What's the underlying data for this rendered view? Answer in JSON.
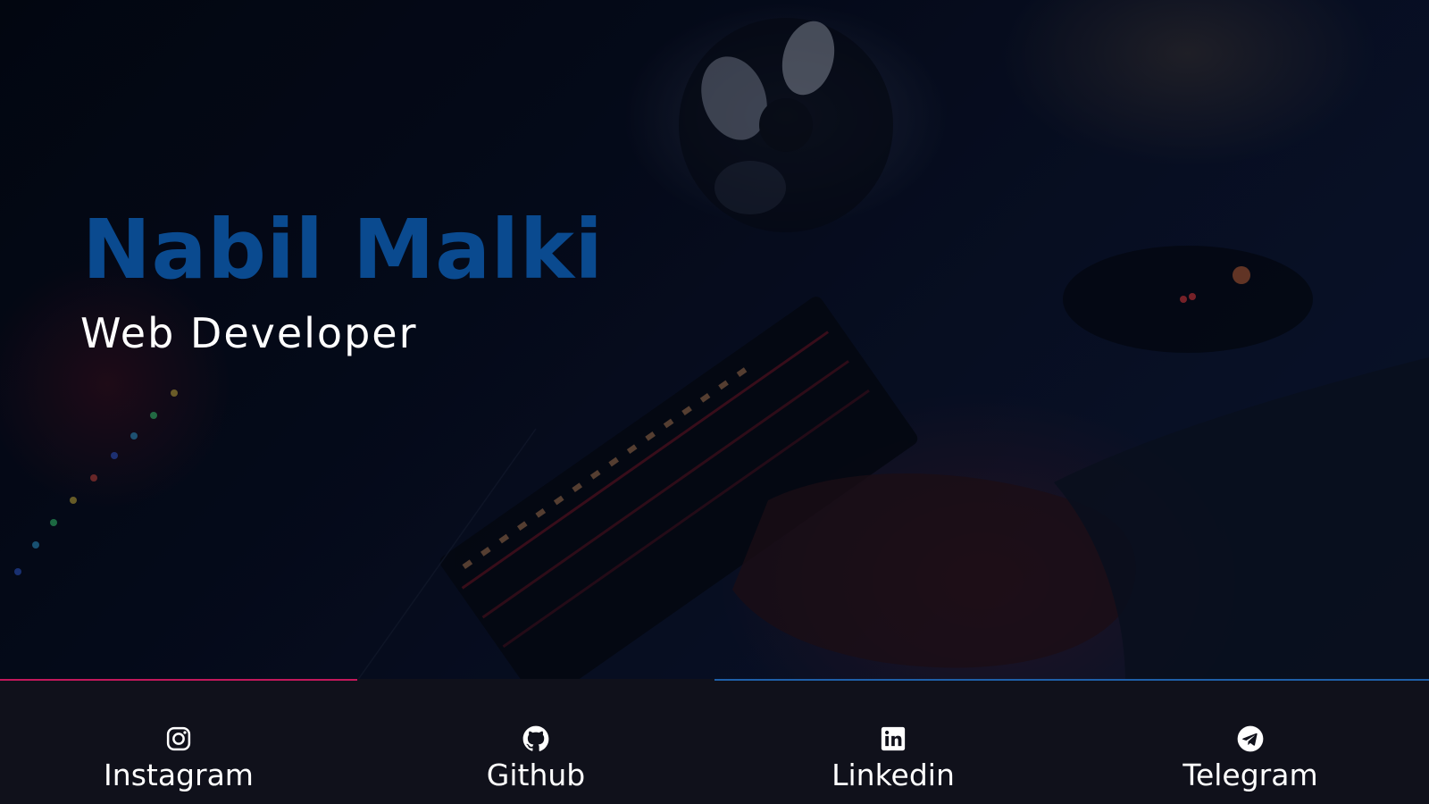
{
  "hero": {
    "name": "Nabil Malki",
    "role": "Web Developer"
  },
  "socials": [
    {
      "label": "Instagram",
      "icon": "instagram-icon"
    },
    {
      "label": "Github",
      "icon": "github-icon"
    },
    {
      "label": "Linkedin",
      "icon": "linkedin-icon"
    },
    {
      "label": "Telegram",
      "icon": "telegram-icon"
    }
  ],
  "colors": {
    "name": "#0a4a8f",
    "role": "#ffffff",
    "footer_bg": "#10111b",
    "accent_red": "#c2185b",
    "accent_blue": "#1e5fa8"
  }
}
